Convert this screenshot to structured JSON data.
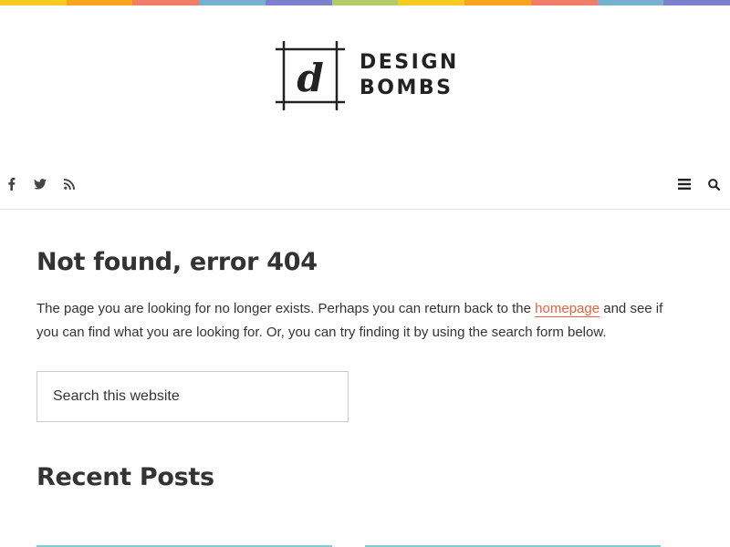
{
  "top_bar": {
    "colors": [
      "#f7cb1f",
      "#f7a51f",
      "#f07e6a",
      "#77b1cf",
      "#7f7fcf",
      "#b3cc6a",
      "#f7cb1f",
      "#f7a51f",
      "#f07e6a",
      "#77b1cf",
      "#7f7fcf"
    ]
  },
  "brand": {
    "logo_letter": "d",
    "name_line1": "DESIGN",
    "name_line2": "BOMBS"
  },
  "social": {
    "icons": [
      "facebook-icon",
      "twitter-icon",
      "rss-icon"
    ]
  },
  "tools": {
    "icons": [
      "menu-icon",
      "search-icon"
    ]
  },
  "main": {
    "title": "Not found, error 404",
    "body_before_link": "The page you are looking for no longer exists. Perhaps you can return back to the ",
    "link_text": "homepage",
    "body_after_link": " and see if you can find what you are looking for. Or, you can try finding it by using the search form below.",
    "search_placeholder": "Search this website",
    "section_title": "Recent Posts"
  },
  "colors": {
    "link": "#e8603c",
    "card_accent": "#7ecdd4",
    "text": "#333333"
  }
}
